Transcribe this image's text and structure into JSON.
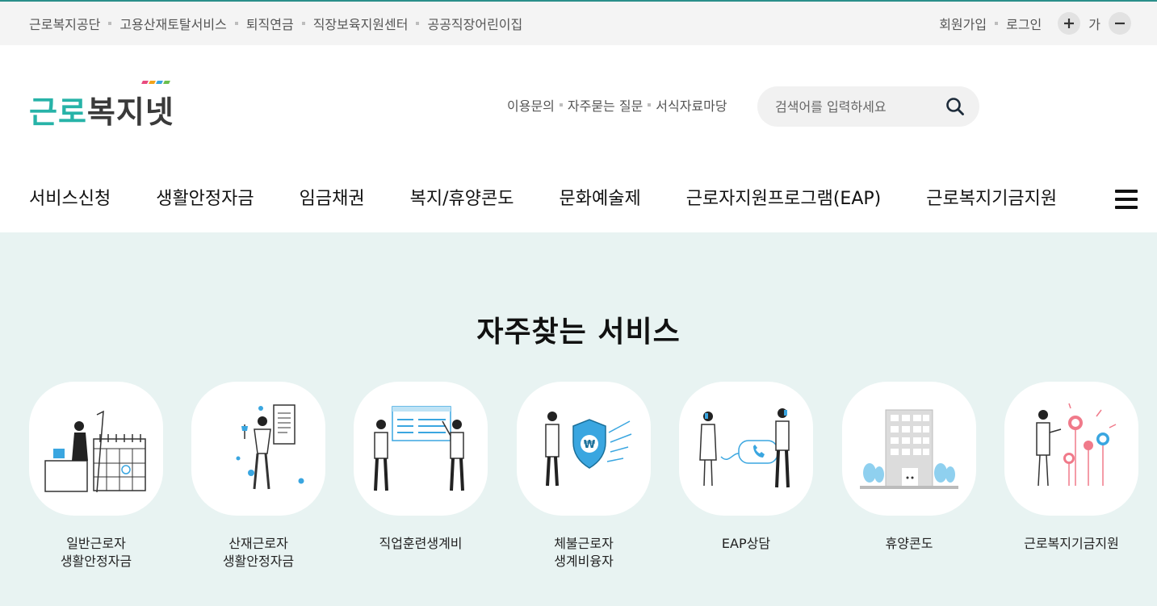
{
  "topbar": {
    "links": [
      "근로복지공단",
      "고용산재토탈서비스",
      "퇴직연금",
      "직장보육지원센터",
      "공공직장어린이집"
    ],
    "join": "회원가입",
    "login": "로그인",
    "font_size_label": "가",
    "plus_icon": "plus-icon",
    "minus_icon": "minus-icon"
  },
  "header": {
    "logo_text_a": "근로",
    "logo_text_b": "복지넷",
    "logo_bar_colors": [
      "#e84a7f",
      "#f2a31a",
      "#3aa6e0",
      "#6bbf4e"
    ],
    "util_links": [
      "이용문의",
      "자주묻는 질문",
      "서식자료마당"
    ],
    "search": {
      "placeholder": "검색어를 입력하세요",
      "icon": "search-icon"
    },
    "nav": [
      "서비스신청",
      "생활안정자금",
      "임금채권",
      "복지/휴양콘도",
      "문화예술제",
      "근로자지원프로그램(EAP)",
      "근로복지기금지원"
    ],
    "menu_icon": "hamburger-icon"
  },
  "main": {
    "title": "자주찾는 서비스",
    "services": [
      {
        "line1": "일반근로자",
        "line2": "생활안정자금",
        "icon": "office-worker-calendar-icon"
      },
      {
        "line1": "산재근로자",
        "line2": "생활안정자금",
        "icon": "injured-worker-document-icon"
      },
      {
        "line1": "직업훈련생계비",
        "line2": "",
        "icon": "training-presentation-icon"
      },
      {
        "line1": "체불근로자",
        "line2": "생계비융자",
        "icon": "shield-won-icon"
      },
      {
        "line1": "EAP상담",
        "line2": "",
        "icon": "phone-consult-icon"
      },
      {
        "line1": "휴양콘도",
        "line2": "",
        "icon": "condo-building-icon"
      },
      {
        "line1": "근로복지기금지원",
        "line2": "",
        "icon": "fund-flower-icon"
      }
    ]
  },
  "colors": {
    "accent": "#27b3a8",
    "main_bg": "#e8f3f2",
    "icon_blue": "#3aa6e0",
    "icon_pink": "#f07a8a"
  }
}
